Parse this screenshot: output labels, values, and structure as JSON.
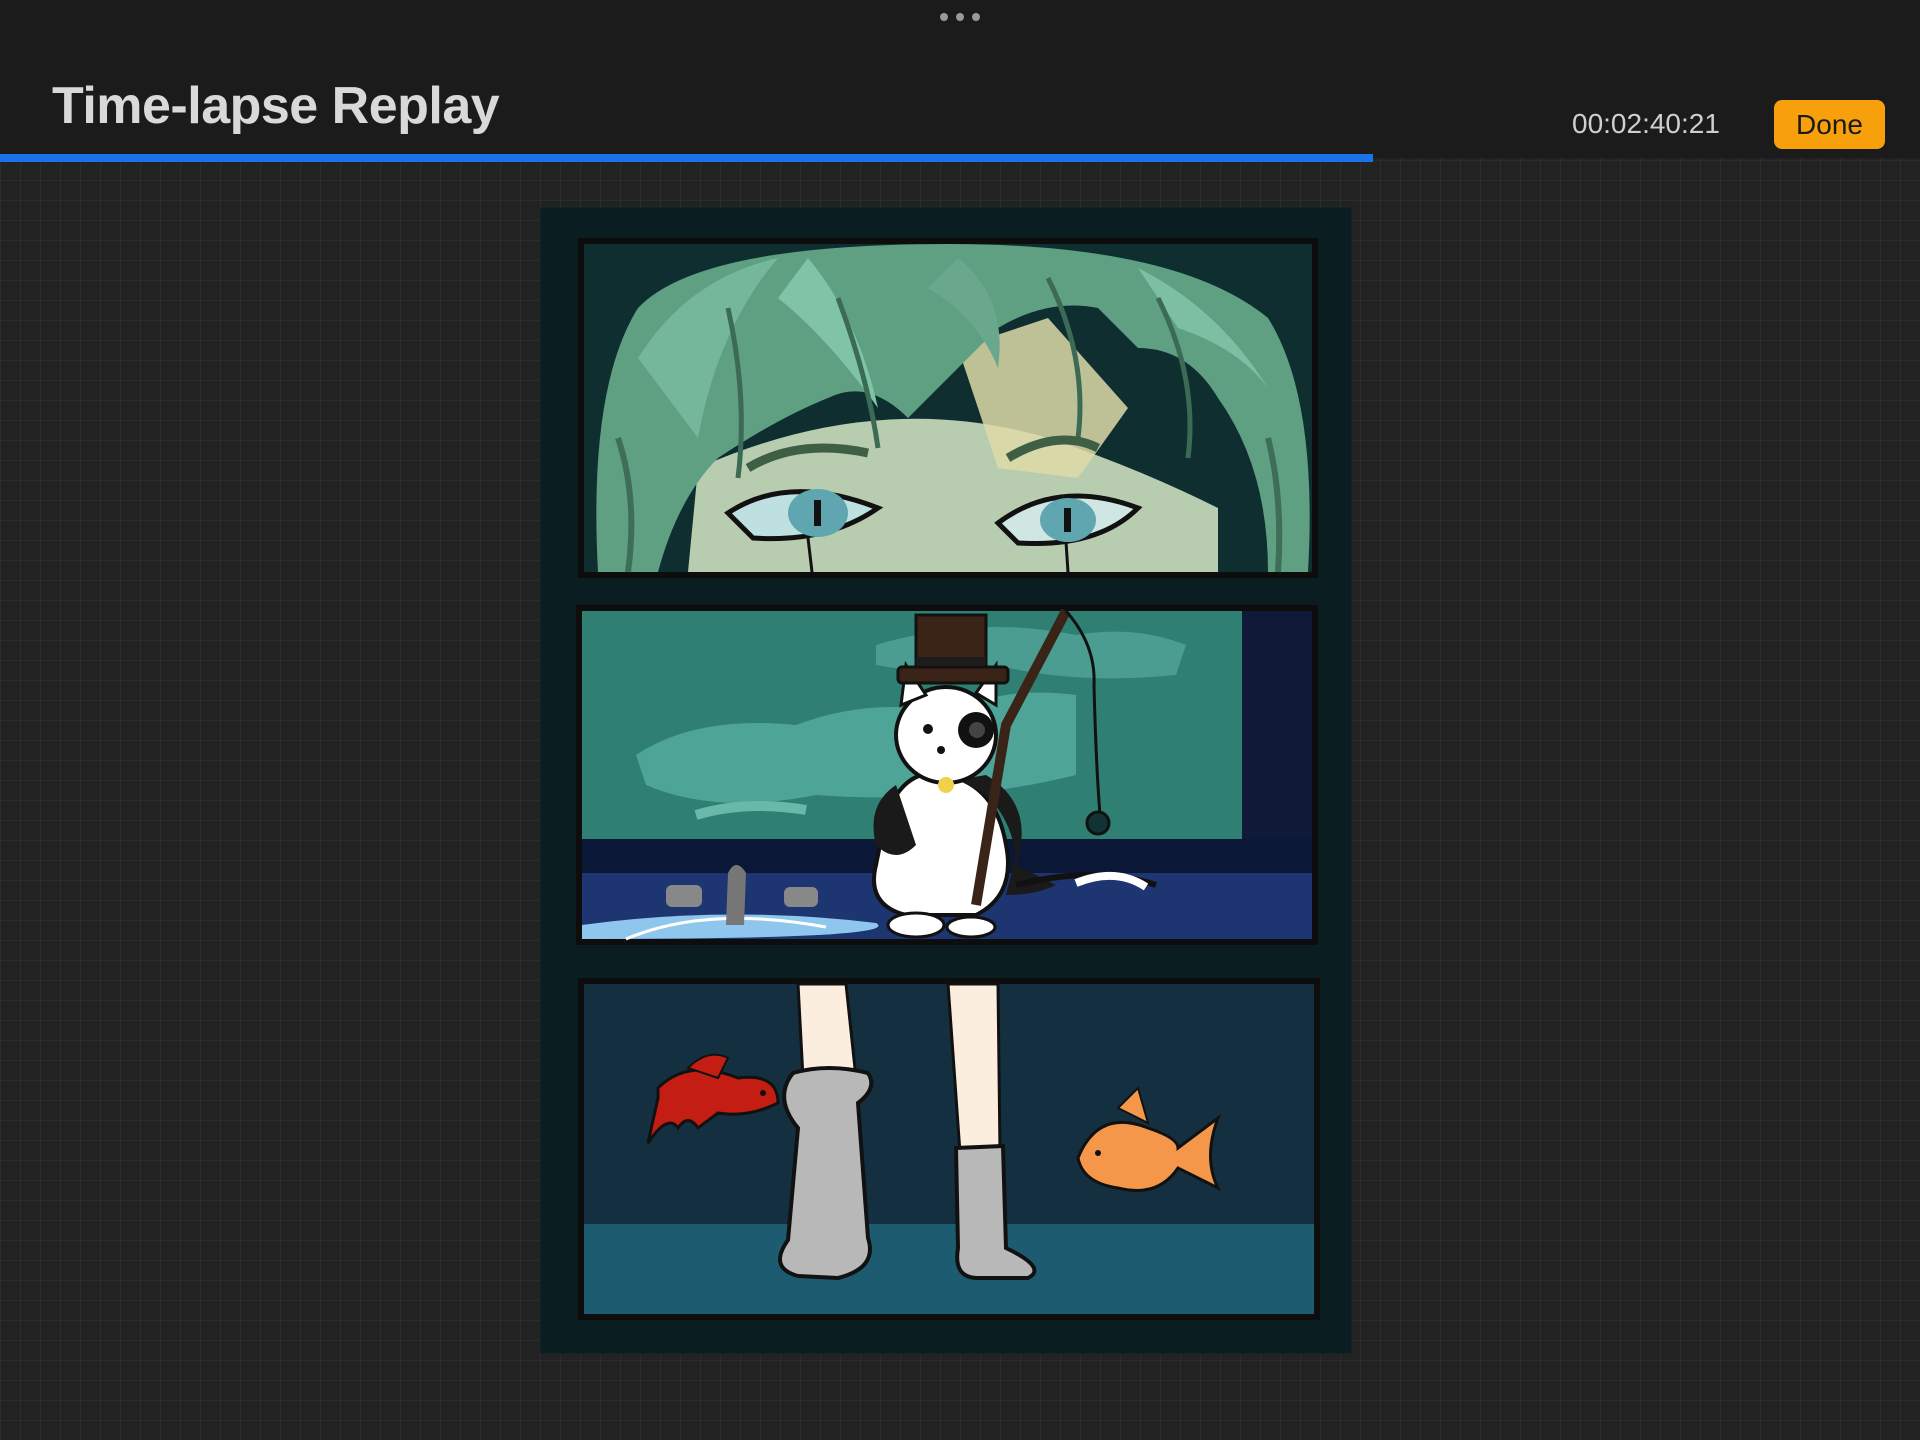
{
  "header": {
    "title": "Time-lapse Replay",
    "timecode": "00:02:40:21",
    "done_label": "Done"
  },
  "playback": {
    "progress_fraction": 0.715
  },
  "colors": {
    "accent_done": "#f7a00c",
    "progress_blue": "#1a73e8",
    "canvas_dark": "#0a1e22"
  },
  "artwork": {
    "panels": [
      "face-closeup",
      "cat-fishing",
      "legs-and-fish"
    ]
  }
}
